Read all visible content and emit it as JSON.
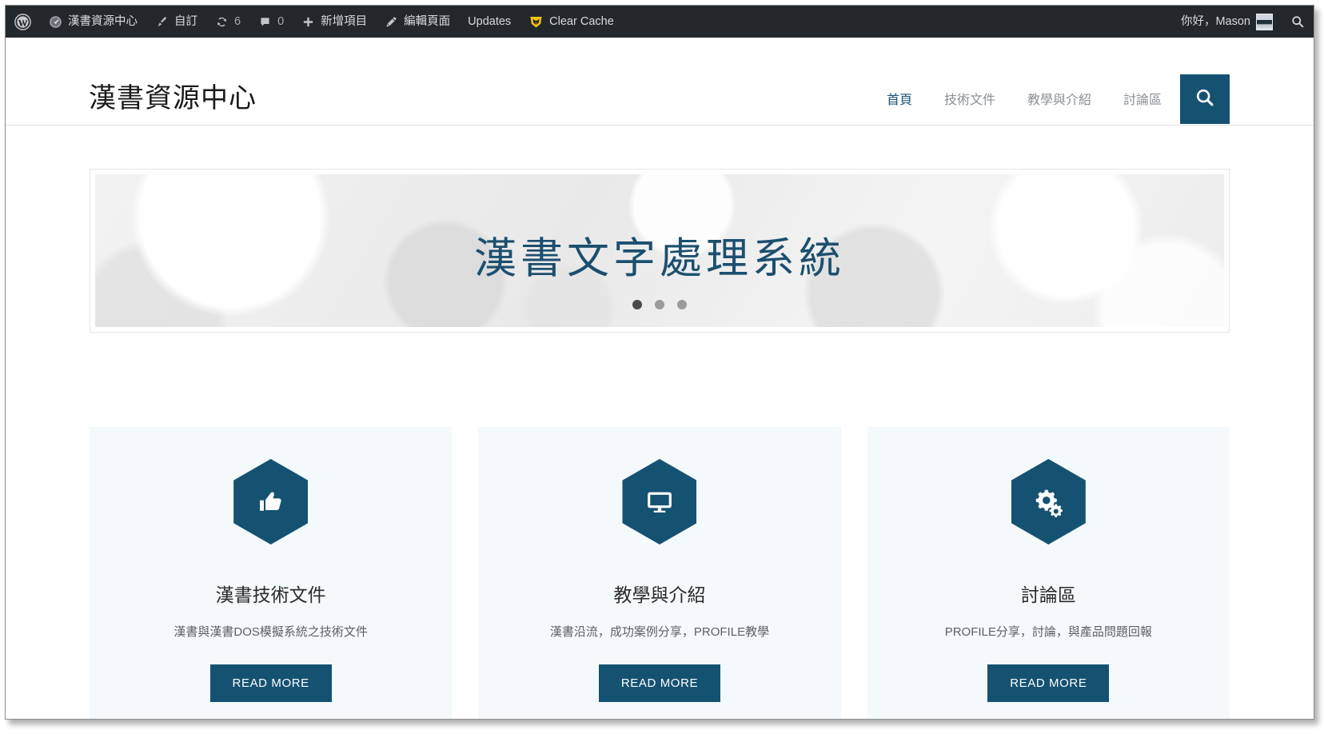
{
  "admin_bar": {
    "left_items": [
      {
        "icon": "wordpress-logo-icon",
        "label": ""
      },
      {
        "icon": "dashboard-speedometer-icon",
        "label": "漢書資源中心"
      },
      {
        "icon": "paintbrush-icon",
        "label": "自訂"
      },
      {
        "icon": "updates-arrows-icon",
        "label": "6"
      },
      {
        "icon": "comment-bubble-icon",
        "label": "0"
      },
      {
        "icon": "plus-icon",
        "label": "新增項目"
      },
      {
        "icon": "pencil-icon",
        "label": "編輯頁面"
      },
      {
        "icon": "",
        "label": "Updates"
      },
      {
        "icon": "wp-rocket-shield-icon",
        "label": "Clear Cache"
      }
    ],
    "greeting": "你好，Mason",
    "avatar_name": "avatar",
    "search_icon": "search-icon"
  },
  "header": {
    "site_title": "漢書資源中心",
    "nav": [
      {
        "label": "首頁",
        "active": true
      },
      {
        "label": "技術文件",
        "active": false
      },
      {
        "label": "教學與介紹",
        "active": false
      },
      {
        "label": "討論區",
        "active": false
      }
    ],
    "search_button_icon": "search-icon",
    "accent_color": "#155272"
  },
  "hero": {
    "title": "漢書文字處理系統",
    "title_color": "#1c4f6e",
    "dots": [
      {
        "active": true
      },
      {
        "active": false
      },
      {
        "active": false
      }
    ]
  },
  "cards": [
    {
      "icon": "thumbs-up-icon",
      "title": "漢書技術文件",
      "description": "漢書與漢書DOS模擬系統之技術文件",
      "button_label": "READ MORE"
    },
    {
      "icon": "desktop-monitor-icon",
      "title": "教學與介紹",
      "description": "漢書沿流，成功案例分享，PROFILE教學",
      "button_label": "READ MORE"
    },
    {
      "icon": "cogs-icon",
      "title": "討論區",
      "description": "PROFILE分享，討論，與產品問題回報",
      "button_label": "READ MORE"
    }
  ]
}
